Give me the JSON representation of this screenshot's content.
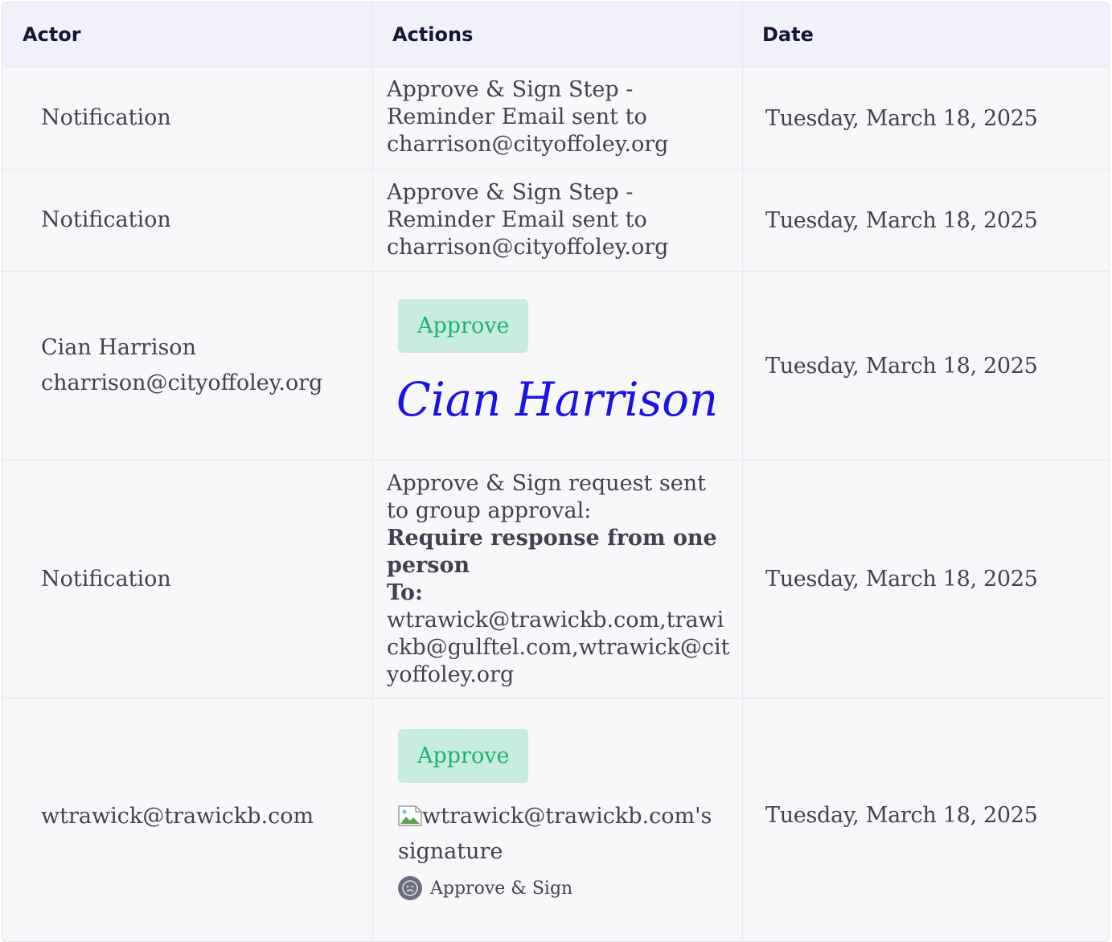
{
  "header": {
    "actor": "Actor",
    "actions": "Actions",
    "date": "Date"
  },
  "rows": [
    {
      "actor": "Notification",
      "action": "Approve & Sign Step - Reminder Email sent to charrison@cityoffoley.org",
      "date": "Tuesday, March 18, 2025"
    },
    {
      "actor": "Notification",
      "action": "Approve & Sign Step - Reminder Email sent to charrison@cityoffoley.org",
      "date": "Tuesday, March 18, 2025"
    },
    {
      "actor_name": "Cian Harrison",
      "actor_email": "charrison@cityoffoley.org",
      "approve_label": "Approve",
      "signature_text": "Cian Harrison",
      "date": "Tuesday, March 18, 2025"
    },
    {
      "actor": "Notification",
      "action_intro": "Approve & Sign request sent to group approval:",
      "action_bold": "Require response from one person",
      "to_label": "To:",
      "recipients": "wtrawick@trawickb.com,trawickb@gulftel.com,wtrawick@cityoffoley.org",
      "date": "Tuesday, March 18, 2025"
    },
    {
      "actor": "wtrawick@trawickb.com",
      "approve_label": "Approve",
      "signature_alt": "wtrawick@trawickb.com's signature",
      "step_label": "Approve & Sign",
      "date": "Tuesday, March 18, 2025"
    }
  ],
  "colors": {
    "header_bg": "#f0f1fa",
    "row_bg": "#f8f8fb",
    "approve_bg": "#c8ecdf",
    "approve_text": "#1bb36a",
    "signature_ink": "#1a12e6"
  }
}
